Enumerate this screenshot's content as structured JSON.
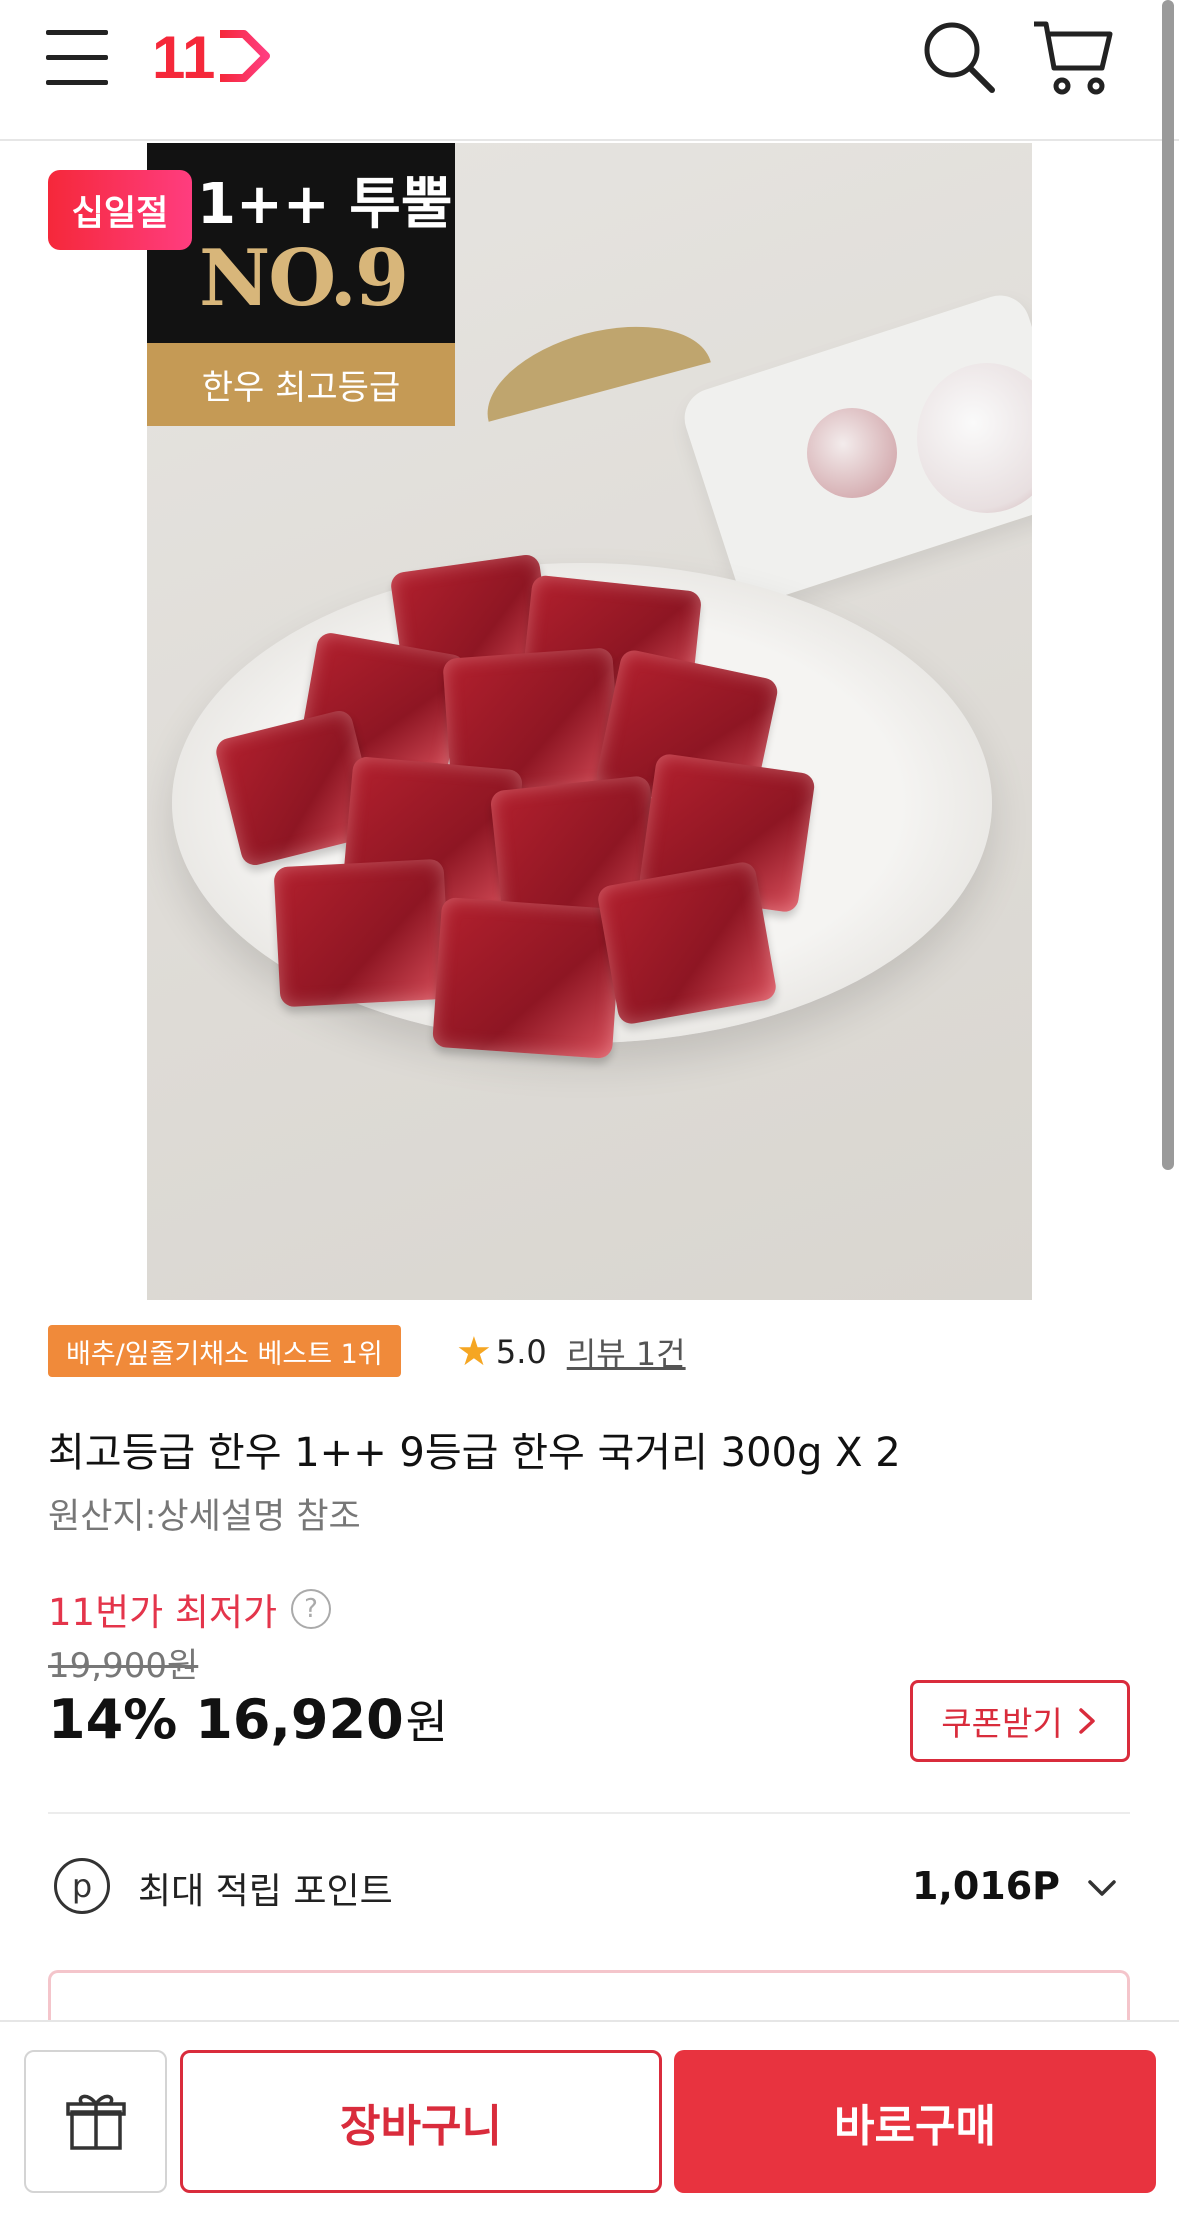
{
  "header": {
    "logo_text": "11",
    "menu_icon": "hamburger-menu-icon",
    "search_icon": "search-icon",
    "cart_icon": "shopping-cart-icon"
  },
  "product_image": {
    "festival_tag": "십일절",
    "grade_text": "1++ 투뿔",
    "number_text": "NO.9",
    "grade_caption": "한우 최고등급"
  },
  "ranking_badge": "배추/잎줄기채소 베스트 1위",
  "rating": {
    "score": "5.0",
    "review_link": "리뷰 1건"
  },
  "product": {
    "title": "최고등급 한우 1++ 9등급 한우 국거리 300g X 2",
    "origin": "원산지:상세설명 참조"
  },
  "price": {
    "lowest_label": "11번가 최저가",
    "help_mark": "?",
    "original": "19,900원",
    "discount": "14%",
    "sale_price": "16,920",
    "currency": "원",
    "coupon_button": "쿠폰받기"
  },
  "points": {
    "icon_letter": "p",
    "label": "최대 적립 포인트",
    "value": "1,016P"
  },
  "bottom_bar": {
    "gift_icon": "gift-icon",
    "cart_button": "장바구니",
    "buy_button": "바로구매"
  },
  "colors": {
    "brand_red": "#e8333f",
    "badge_orange": "#f08a3a",
    "lowest_price_red": "#e4354b"
  }
}
